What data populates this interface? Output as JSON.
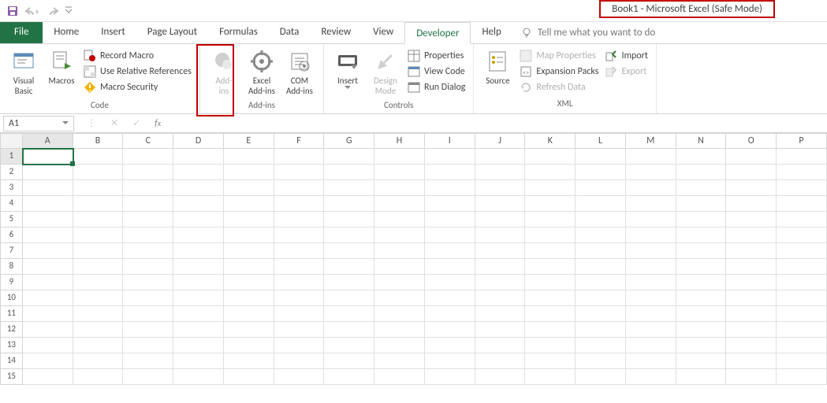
{
  "title": "Book1  -  Microsoft Excel (Safe Mode)",
  "tabs": {
    "file": "File",
    "items": [
      "Home",
      "Insert",
      "Page Layout",
      "Formulas",
      "Data",
      "Review",
      "View",
      "Developer",
      "Help"
    ],
    "active": "Developer",
    "tellme": "Tell me what you want to do"
  },
  "ribbon": {
    "code": {
      "visual_basic": "Visual\nBasic",
      "macros": "Macros",
      "record_macro": "Record Macro",
      "use_relative": "Use Relative References",
      "macro_security": "Macro Security",
      "label": "Code"
    },
    "addins": {
      "addins": "Add-\nins",
      "excel_addins": "Excel\nAdd-ins",
      "com_addins": "COM\nAdd-ins",
      "label": "Add-ins"
    },
    "controls": {
      "insert": "Insert",
      "design_mode": "Design\nMode",
      "properties": "Properties",
      "view_code": "View Code",
      "run_dialog": "Run Dialog",
      "label": "Controls"
    },
    "xml": {
      "source": "Source",
      "map_properties": "Map Properties",
      "expansion_packs": "Expansion Packs",
      "refresh_data": "Refresh Data",
      "import": "Import",
      "export": "Export",
      "label": "XML"
    }
  },
  "namebox": "A1",
  "columns": [
    "A",
    "B",
    "C",
    "D",
    "E",
    "F",
    "G",
    "H",
    "I",
    "J",
    "K",
    "L",
    "M",
    "N",
    "O",
    "P"
  ],
  "rows": [
    "1",
    "2",
    "3",
    "4",
    "5",
    "6",
    "7",
    "8",
    "9",
    "10",
    "11",
    "12",
    "13",
    "14",
    "15"
  ]
}
